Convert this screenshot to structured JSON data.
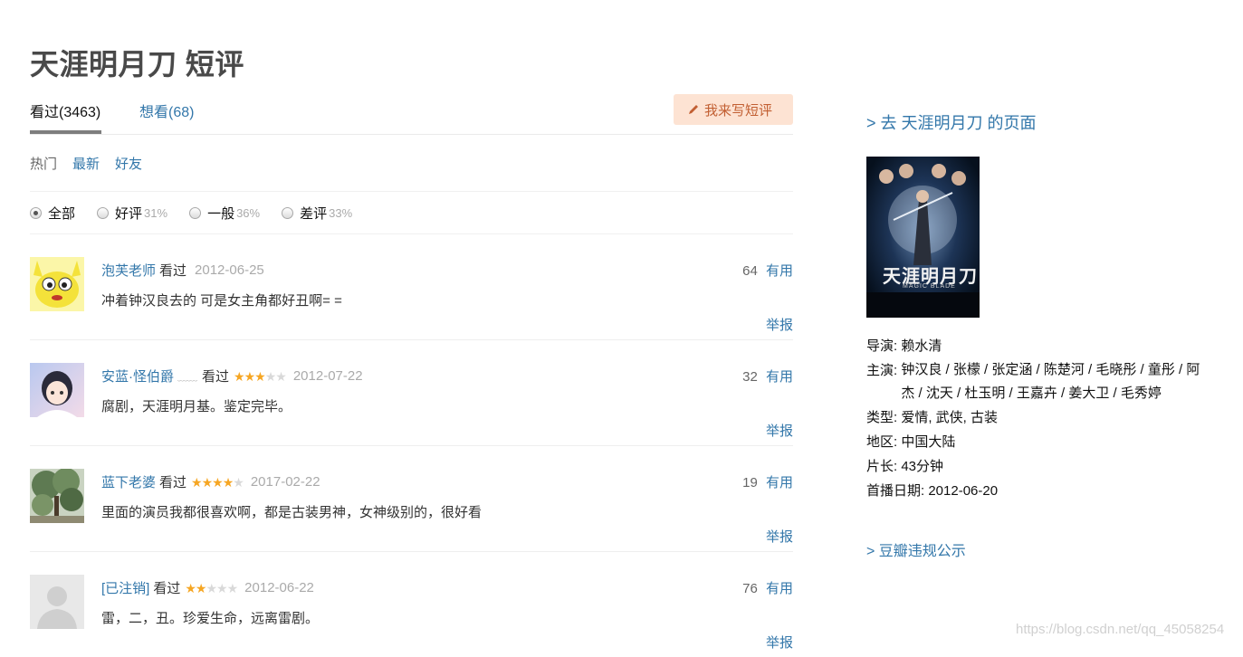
{
  "page": {
    "title": "天涯明月刀 短评"
  },
  "tabs": {
    "watched": "看过(3463)",
    "wish": "想看(68)",
    "write_button": "我来写短评"
  },
  "sort": {
    "current": "热门",
    "newest": "最新",
    "friends": "好友"
  },
  "filter": {
    "options": [
      {
        "label": "全部",
        "pct": "",
        "selected": true
      },
      {
        "label": "好评",
        "pct": "31%",
        "selected": false
      },
      {
        "label": "一般",
        "pct": "36%",
        "selected": false
      },
      {
        "label": "差评",
        "pct": "33%",
        "selected": false
      }
    ]
  },
  "comments": [
    {
      "user": "泡芙老师",
      "watched": "看过",
      "rating": 0,
      "date": "2012-06-25",
      "votes": "64",
      "useful": "有用",
      "text": "冲着钟汉良去的 可是女主角都好丑啊= =",
      "report": "举报"
    },
    {
      "user": "安蓝·怪伯爵",
      "watched": "看过",
      "rating": 3,
      "date": "2012-07-22",
      "votes": "32",
      "useful": "有用",
      "text": "腐剧，天涯明月基。鉴定完毕。",
      "report": "举报"
    },
    {
      "user": "蓝下老婆",
      "watched": "看过",
      "rating": 4,
      "date": "2017-02-22",
      "votes": "19",
      "useful": "有用",
      "text": "里面的演员我都很喜欢啊，都是古装男神，女神级别的，很好看",
      "report": "举报"
    },
    {
      "user": "[已注销]",
      "watched": "看过",
      "rating": 2,
      "date": "2012-06-22",
      "votes": "76",
      "useful": "有用",
      "text": "雷，二，丑。珍爱生命，远离雷剧。",
      "report": "举报"
    }
  ],
  "aside": {
    "goto": "> 去 天涯明月刀 的页面",
    "poster_title": "天涯明月刀",
    "poster_subtitle": "MAGIC BLADE",
    "director_label": "导演:",
    "director": "赖水清",
    "cast_label": "主演:",
    "cast": "钟汉良 / 张檬 / 张定涵 / 陈楚河 / 毛晓彤 / 童彤 / 阿杰 / 沈天 / 杜玉明 / 王嘉卉 / 姜大卫 / 毛秀婷",
    "genre_label": "类型:",
    "genre": "爱情, 武侠, 古装",
    "region_label": "地区:",
    "region": "中国大陆",
    "length_label": "片长:",
    "length": "43分钟",
    "premiere_label": "首播日期:",
    "premiere": "2012-06-20",
    "violation": "> 豆瓣违规公示"
  },
  "watermark": "https://blog.csdn.net/qq_45058254",
  "colors": {
    "link": "#3377aa",
    "star": "#f6a623",
    "button_bg": "#fde3d3",
    "button_text": "#c25f32"
  }
}
